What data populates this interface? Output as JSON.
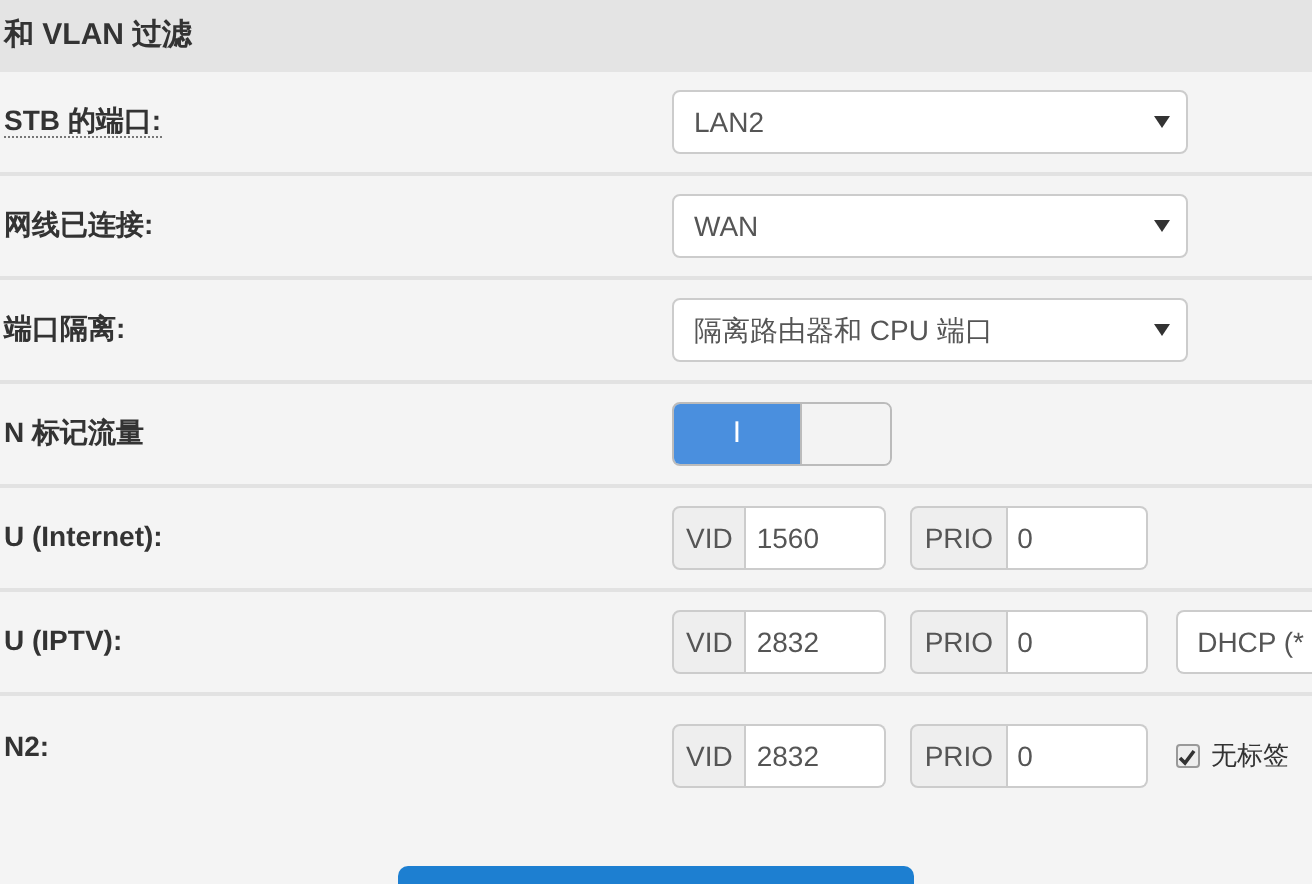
{
  "section_title": "和 VLAN 过滤",
  "rows": [
    {
      "kind": "select",
      "label": "STB 的端口:",
      "underlined": true,
      "value": "LAN2"
    },
    {
      "kind": "select",
      "label": "网线已连接:",
      "underlined": false,
      "value": "WAN"
    },
    {
      "kind": "select",
      "label": "端口隔离:",
      "underlined": false,
      "value": "隔离路由器和 CPU 端口"
    },
    {
      "kind": "toggle",
      "label": "N 标记流量",
      "underlined": false,
      "on": true,
      "on_label": "I"
    },
    {
      "kind": "vlan",
      "label": "U (Internet):",
      "underlined": false,
      "vid_label": "VID",
      "vid": "1560",
      "prio_label": "PRIO",
      "prio": "0"
    },
    {
      "kind": "vlan",
      "label": "U (IPTV):",
      "underlined": false,
      "vid_label": "VID",
      "vid": "2832",
      "prio_label": "PRIO",
      "prio": "0",
      "extra": {
        "kind": "select",
        "value": "DHCP (*"
      }
    },
    {
      "kind": "vlan",
      "label": "N2:",
      "underlined": false,
      "vid_label": "VID",
      "vid": "2832",
      "prio_label": "PRIO",
      "prio": "0",
      "extra": {
        "kind": "checkbox",
        "checked": true,
        "label": "无标签"
      }
    }
  ]
}
